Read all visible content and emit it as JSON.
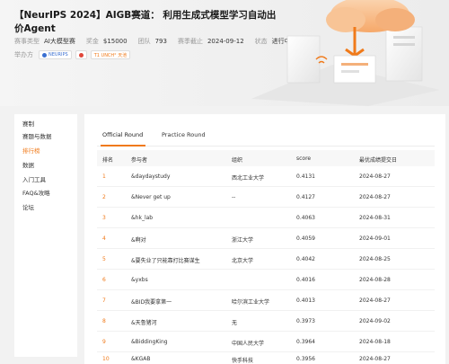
{
  "header": {
    "title": "【NeurIPS 2024】AIGB赛道： 利用生成式模型学习自动出价Agent",
    "meta": [
      {
        "key": "赛事类型",
        "value": "AI大模型赛"
      },
      {
        "key": "奖金",
        "value": "$15000"
      },
      {
        "key": "团队",
        "value": "793"
      },
      {
        "key": "赛季截止",
        "value": "2024-09-12"
      },
      {
        "key": "状态",
        "value": "进行中"
      }
    ],
    "sponsors_label": "举办方",
    "sponsors": [
      {
        "name": "NEURIPS",
        "color": "#3a6fd1"
      },
      {
        "name": "",
        "color": "#e0463a"
      },
      {
        "name": "T1 UNCH° 天池",
        "color": "#f07a1a"
      }
    ]
  },
  "sidebar": {
    "items": [
      {
        "label": "赛制",
        "active": false
      },
      {
        "label": "赛题与数据",
        "active": false
      },
      {
        "label": "排行榜",
        "active": true
      },
      {
        "label": "数据",
        "active": false
      },
      {
        "label": "入门工具",
        "active": false
      },
      {
        "label": "FAQ&攻略",
        "active": false
      },
      {
        "label": "论坛",
        "active": false
      }
    ]
  },
  "tabs": [
    {
      "label": "Official Round",
      "active": true
    },
    {
      "label": "Practice Round",
      "active": false
    }
  ],
  "table": {
    "headers": [
      "排名",
      "参与者",
      "组织",
      "score",
      "最优成绩提交日"
    ],
    "rows": [
      {
        "rank": "1",
        "name": "&daydaystudy",
        "org": "西北工业大学",
        "score": "0.4131",
        "date": "2024-08-27"
      },
      {
        "rank": "2",
        "name": "&Never get up",
        "org": "--",
        "score": "0.4127",
        "date": "2024-08-27"
      },
      {
        "rank": "3",
        "name": "&hk_lab",
        "org": "",
        "score": "0.4063",
        "date": "2024-08-31"
      },
      {
        "rank": "4",
        "name": "&啊对",
        "org": "浙江大学",
        "score": "0.4059",
        "date": "2024-09-01"
      },
      {
        "rank": "5",
        "name": "&要失业了只能靠打比赛谋生",
        "org": "北京大学",
        "score": "0.4042",
        "date": "2024-08-25"
      },
      {
        "rank": "6",
        "name": "&yxbs",
        "org": "",
        "score": "0.4016",
        "date": "2024-08-28"
      },
      {
        "rank": "7",
        "name": "&BID我要拿第一",
        "org": "哈尔滨工业大学",
        "score": "0.4013",
        "date": "2024-08-27"
      },
      {
        "rank": "8",
        "name": "&天鲁猪河",
        "org": "无",
        "score": "0.3973",
        "date": "2024-09-02"
      },
      {
        "rank": "9",
        "name": "&BiddingKing",
        "org": "中国人民大学",
        "score": "0.3964",
        "date": "2024-08-18"
      },
      {
        "rank": "10",
        "name": "&KGAB",
        "org": "快手科技",
        "score": "0.3956",
        "date": "2024-08-27"
      }
    ]
  },
  "colors": {
    "accent": "#f07a1a",
    "background": "#f2f2f2",
    "panel": "#ffffff"
  }
}
